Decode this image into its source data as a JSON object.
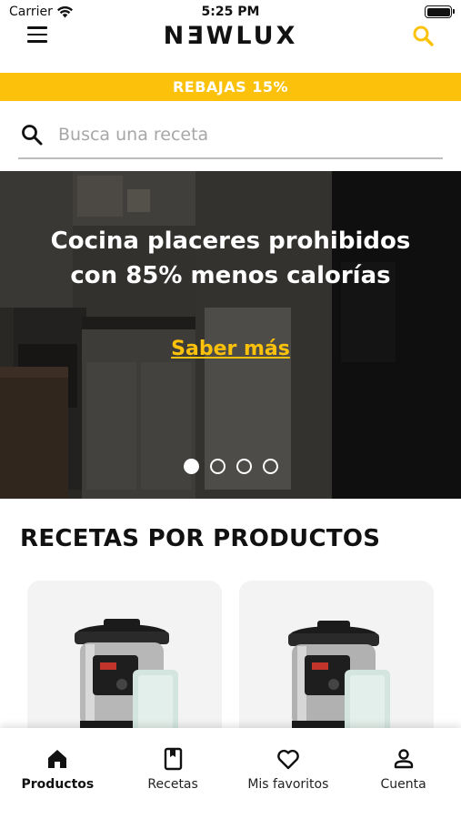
{
  "status_bar": {
    "carrier": "Carrier",
    "time": "5:25 PM",
    "icons": [
      "wifi-icon",
      "battery-icon"
    ]
  },
  "header": {
    "logo": "NƎWLUX",
    "menu_icon": "hamburger-menu-icon",
    "search_icon": "search-icon"
  },
  "promo": {
    "text": "REBAJAS 15%"
  },
  "search": {
    "placeholder": "Busca una receta",
    "value": ""
  },
  "hero": {
    "title": "Cocina placeres prohibidos con 85% menos calorías",
    "link": "Saber más",
    "slides_total": 4,
    "active_slide": 1
  },
  "section": {
    "title": "RECETAS POR PRODUCTOS"
  },
  "products": [
    {
      "image": "pressure-cooker-image"
    },
    {
      "image": "pressure-cooker-image"
    }
  ],
  "tabs": [
    {
      "label": "Productos",
      "icon": "home-icon",
      "active": true
    },
    {
      "label": "Recetas",
      "icon": "book-icon",
      "active": false
    },
    {
      "label": "Mis favoritos",
      "icon": "heart-icon",
      "active": false
    },
    {
      "label": "Cuenta",
      "icon": "user-icon",
      "active": false
    }
  ],
  "colors": {
    "accent": "#fcc10a",
    "text": "#111111",
    "card_bg": "#f3f3f3"
  }
}
